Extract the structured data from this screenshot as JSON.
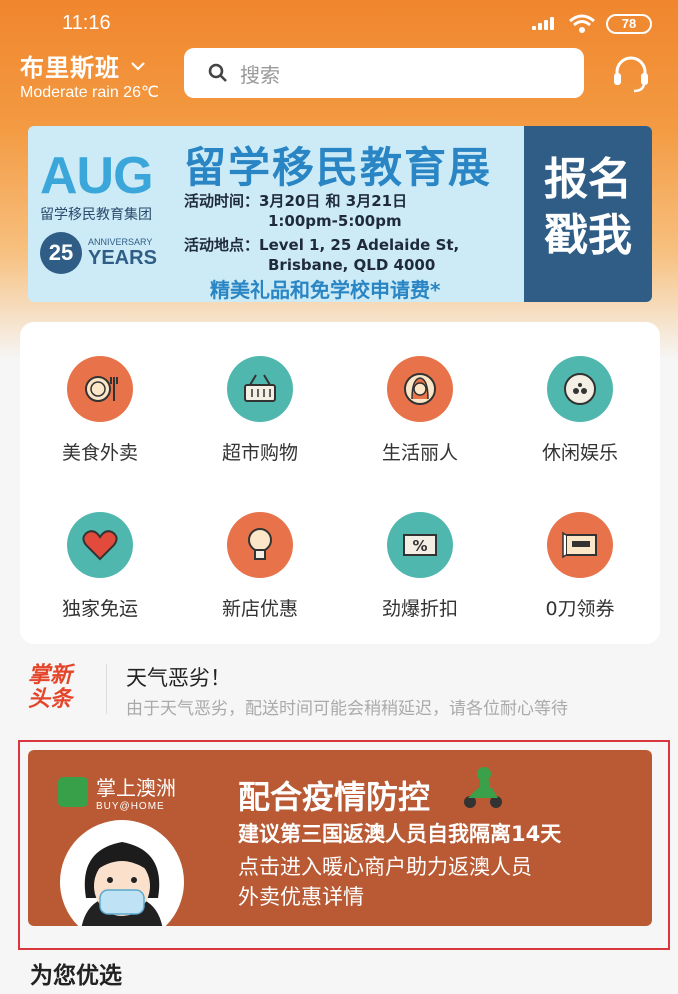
{
  "status_bar": {
    "time": "11:16",
    "battery": "78"
  },
  "header": {
    "city": "布里斯班",
    "weather": "Moderate rain 26℃",
    "search_placeholder": "搜索"
  },
  "banner": {
    "logo": "AUG",
    "logo_sub": "留学移民教育集团",
    "anniv_num": "25",
    "anniv_top": "ANNIVERSARY",
    "anniv_bottom": "YEARS",
    "title": "留学移民教育展",
    "time_label": "活动时间：",
    "time_line1": "3月20日 和 3月21日",
    "time_line2": "1:00pm-5:00pm",
    "place_label": "活动地点：",
    "place_line1": "Level 1, 25 Adelaide St,",
    "place_line2": "Brisbane, QLD 4000",
    "highlight": "精美礼品和免学校申请费*",
    "cta_line1": "报名",
    "cta_line2": "戳我"
  },
  "categories": [
    {
      "label": "美食外卖",
      "icon": "food-icon",
      "color": "#e8734a"
    },
    {
      "label": "超市购物",
      "icon": "basket-icon",
      "color": "#4fb7ad"
    },
    {
      "label": "生活丽人",
      "icon": "beauty-icon",
      "color": "#e8734a"
    },
    {
      "label": "休闲娱乐",
      "icon": "leisure-icon",
      "color": "#4fb7ad"
    },
    {
      "label": "独家免运",
      "icon": "heart-icon",
      "color": "#4fb7ad"
    },
    {
      "label": "新店优惠",
      "icon": "bulb-icon",
      "color": "#e8734a"
    },
    {
      "label": "劲爆折扣",
      "icon": "discount-icon",
      "color": "#4fb7ad"
    },
    {
      "label": "0刀领券",
      "icon": "coupon-icon",
      "color": "#e8734a"
    }
  ],
  "news": {
    "logo_line1": "掌新",
    "logo_line2": "头条",
    "title": "天气恶劣！",
    "subtitle": "由于天气恶劣，配送时间可能会稍稍延迟，请各位耐心等待"
  },
  "promo": {
    "brand": "掌上澳洲",
    "brand_sub": "BUY@HOME",
    "title": "配合疫情防控",
    "line1": "建议第三国返澳人员自我隔离14天",
    "line2": "点击进入暖心商户助力返澳人员",
    "line3": "外卖优惠详情"
  },
  "section": {
    "title": "为您优选"
  }
}
